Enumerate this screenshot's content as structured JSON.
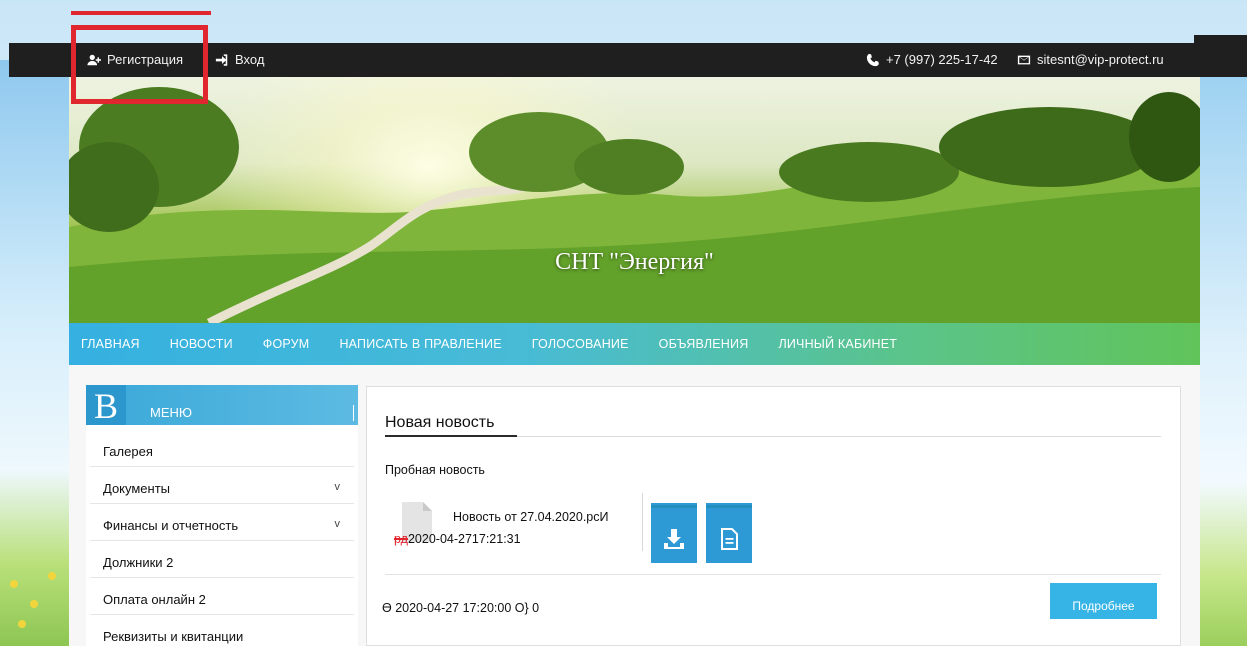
{
  "topbar": {
    "register_label": "Регистрация",
    "login_label": "Вход",
    "phone": "+7 (997) 225-17-42",
    "email": "sitesnt@vip-protect.ru"
  },
  "banner": {
    "title": "СНТ \"Энергия\""
  },
  "nav": {
    "items": [
      "ГЛАВНАЯ",
      "НОВОСТИ",
      "ФОРУМ",
      "НАПИСАТЬ В ПРАВЛЕНИЕ",
      "ГОЛОСОВАНИЕ",
      "ОБЪЯВЛЕНИЯ",
      "ЛИЧНЫЙ КАБИНЕТ"
    ]
  },
  "sidebar": {
    "badge": "B",
    "title": "МЕНЮ",
    "items": [
      {
        "label": "Галерея",
        "chevron": ""
      },
      {
        "label": "Документы",
        "chevron": "v"
      },
      {
        "label": "Финансы и отчетность",
        "chevron": "v"
      },
      {
        "label": "Должники 2",
        "chevron": ""
      },
      {
        "label": "Оплата онлайн 2",
        "chevron": ""
      },
      {
        "label": "Реквизиты и квитанции",
        "chevron": ""
      }
    ]
  },
  "news": {
    "title": "Новая новость",
    "subtitle": "Пробная новость",
    "file_name": "Новость от 27.04.2020.рсИ",
    "file_date_prefix": "рд",
    "file_date": "2020-04-2717:21:31",
    "meta": "ϴ 2020-04-27 17:20:00 О} 0",
    "more_label": "Подробнее"
  },
  "icons": {
    "register": "user-plus-icon",
    "login": "sign-in-icon",
    "phone": "phone-icon",
    "email": "envelope-icon",
    "file": "document-file-icon",
    "download": "download-icon",
    "view": "document-view-icon"
  },
  "colors": {
    "topbar": "#1f1f1f",
    "highlight": "#e0262f",
    "nav_start": "#35b0e0",
    "nav_end": "#61c45a",
    "action_button": "#2d9ad6"
  }
}
